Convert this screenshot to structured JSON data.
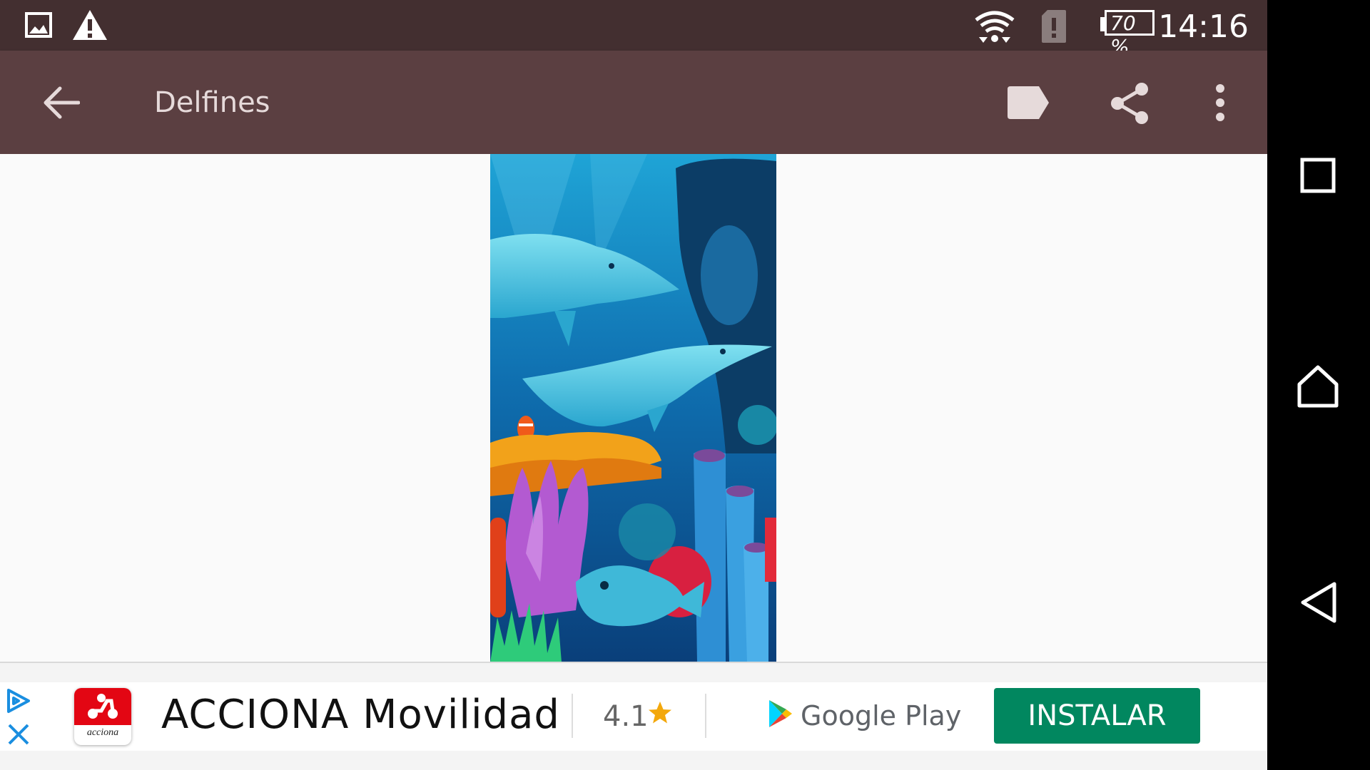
{
  "status_bar": {
    "time": "14:16",
    "battery": "70 %",
    "icons": [
      "image-icon",
      "warning-icon",
      "wifi-icon",
      "sim-alert-icon",
      "battery-icon"
    ]
  },
  "app_bar": {
    "title": "Delfines",
    "icons": [
      "back-arrow-icon",
      "label-icon",
      "share-icon",
      "more-vert-icon"
    ]
  },
  "content": {
    "image_subject": "dolphins-coral-reef"
  },
  "ad": {
    "title": "ACCIONA Movilidad",
    "rating": "4.1",
    "store": "Google Play",
    "button_label": "INSTALAR",
    "button_color": "#01875f",
    "app_icon_text": "acciona",
    "app_icon_color": "#e30613"
  },
  "nav_bar": {
    "icons": [
      "recents-icon",
      "home-icon",
      "back-icon"
    ]
  },
  "colors": {
    "status_bar": "#432f30",
    "app_bar": "#5b3f41",
    "background": "#fafafa"
  }
}
